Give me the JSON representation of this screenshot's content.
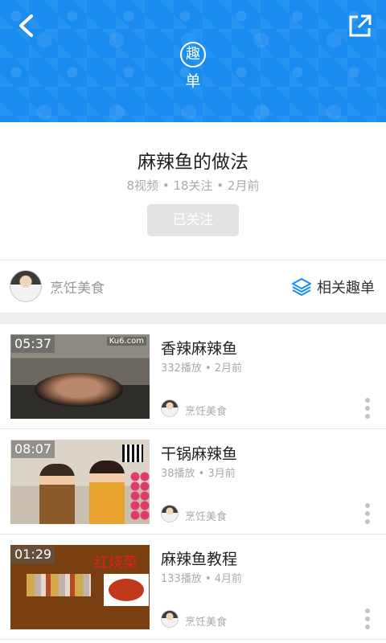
{
  "header": {
    "back_icon": "chevron-left-icon",
    "share_icon": "external-link-icon",
    "badge_char": "趣",
    "badge_label": "单"
  },
  "playlist": {
    "title": "麻辣鱼的做法",
    "meta": "8视频 • 18关注 • 2月前",
    "follow_label": "已关注"
  },
  "author_bar": {
    "name": "烹饪美食",
    "related_label": "相关趣单",
    "related_icon": "layers-icon",
    "accent": "#1a8cf0"
  },
  "videos": [
    {
      "title": "香辣麻辣鱼",
      "meta": "332播放 • 2月前",
      "duration": "05:37",
      "author": "烹饪美食",
      "thumb_logo": "Ku6.com"
    },
    {
      "title": "干锅麻辣鱼",
      "meta": "38播放 • 3月前",
      "duration": "08:07",
      "author": "烹饪美食"
    },
    {
      "title": "麻辣鱼教程",
      "meta": "133播放 • 4月前",
      "duration": "01:29",
      "author": "烹饪美食",
      "thumb_calligraphy": "红烧菜"
    }
  ]
}
